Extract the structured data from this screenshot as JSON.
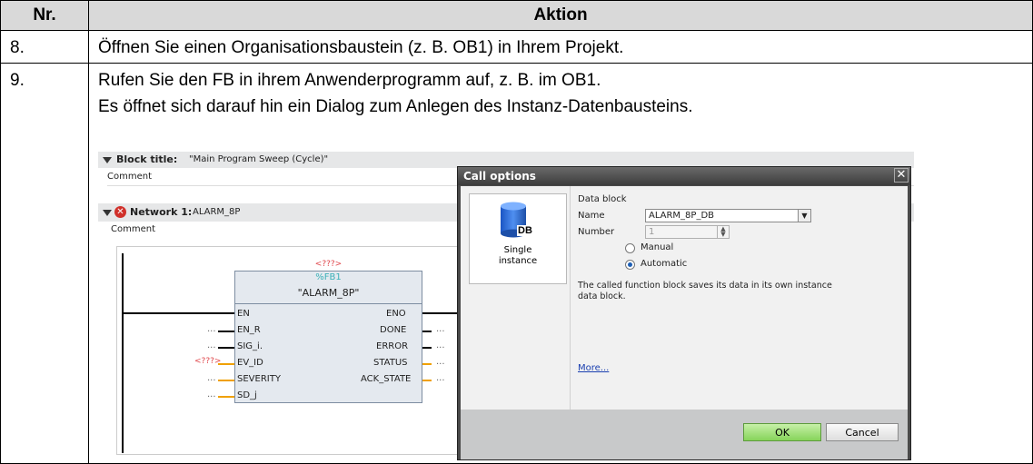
{
  "table": {
    "headers": {
      "nr": "Nr.",
      "aktion": "Aktion"
    },
    "rows": [
      {
        "nr": "8.",
        "text": "Öffnen Sie einen Organisationsbaustein (z. B. OB1) in Ihrem Projekt."
      },
      {
        "nr": "9.",
        "line1": "Rufen Sie den FB in ihrem Anwenderprogramm auf, z. B. im OB1.",
        "line2": "Es öffnet sich darauf hin ein Dialog zum Anlegen des Instanz-Datenbausteins."
      }
    ]
  },
  "editor": {
    "block_title_label": "Block title:",
    "block_title_value": "\"Main Program Sweep (Cycle)\"",
    "comment": "Comment",
    "network_label": "Network 1:",
    "network_name": "ALARM_8P",
    "network_comment": "Comment",
    "fb": {
      "placeholder_top": "<???>",
      "address": "%FB1",
      "name": "\"ALARM_8P\"",
      "inputs": [
        "EN",
        "EN_R",
        "SIG_i.",
        "EV_ID",
        "SEVERITY",
        "SD_j"
      ],
      "outputs": [
        "ENO",
        "DONE",
        "ERROR",
        "STATUS",
        "ACK_STATE"
      ],
      "ev_id_value": "<???>",
      "dots": "..."
    }
  },
  "dialog": {
    "title": "Call options",
    "instance_icon_label": "DB",
    "instance_label_1": "Single",
    "instance_label_2": "instance",
    "section": "Data block",
    "name_label": "Name",
    "name_value": "ALARM_8P_DB",
    "number_label": "Number",
    "number_value": "1",
    "manual": "Manual",
    "automatic": "Automatic",
    "description_1": "The called function block saves its data in its own instance",
    "description_2": "data block.",
    "more": "More...",
    "ok": "OK",
    "cancel": "Cancel"
  }
}
